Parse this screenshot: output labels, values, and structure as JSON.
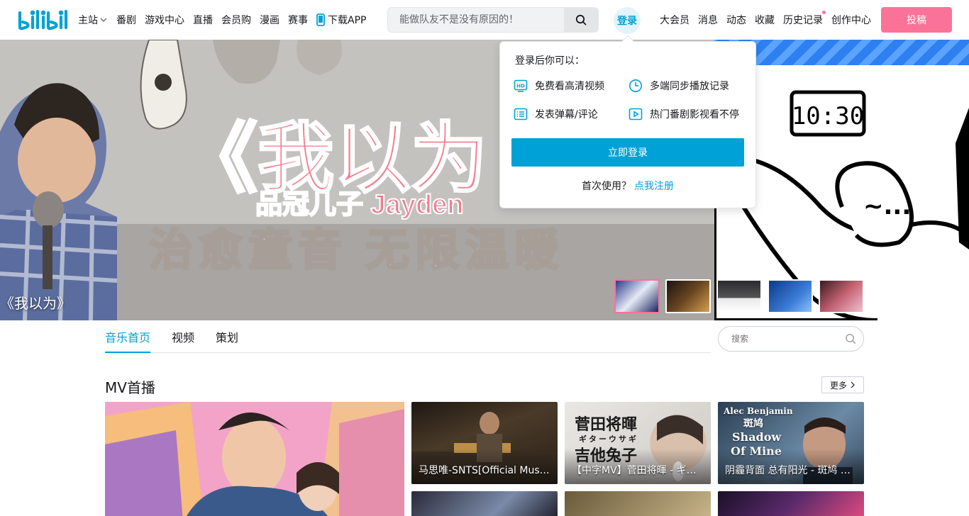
{
  "header": {
    "nav_left": [
      {
        "label": "主站",
        "has_dropdown": true
      },
      {
        "label": "番剧"
      },
      {
        "label": "游戏中心"
      },
      {
        "label": "直播"
      },
      {
        "label": "会员购"
      },
      {
        "label": "漫画"
      },
      {
        "label": "赛事"
      },
      {
        "label": "下载APP",
        "icon": "phone-icon"
      }
    ],
    "search_placeholder": "能做队友不是没有原因的！",
    "login_label": "登录",
    "nav_right": [
      "大会员",
      "消息",
      "动态",
      "收藏",
      "历史记录",
      "创作中心"
    ],
    "upload_label": "投稿"
  },
  "login_popover": {
    "title": "登录后你可以：",
    "features": [
      "免费看高清视频",
      "多端同步播放记录",
      "发表弹幕/评论",
      "热门番剧影视看不停"
    ],
    "login_button": "立即登录",
    "register_prompt": "首次使用？",
    "register_link": "点我注册"
  },
  "banner": {
    "title": "《我以为》",
    "artwork_text": [
      "《我以为",
      "品冠儿子 Jayden",
      "治愈童音 无限温暖"
    ],
    "side_clock": "10:30",
    "side_bubble": "~..."
  },
  "subnav": {
    "tabs": [
      "音乐首页",
      "视频",
      "策划"
    ],
    "search_placeholder": "搜索"
  },
  "mv_section": {
    "title": "MV首播",
    "more_label": "更多",
    "cards": [
      {
        "caption": "马思唯-SNTS[Official Music Video]"
      },
      {
        "caption": "【中字MV】菅田将暉 - ギターウサギ",
        "overlay": [
          "菅田将暉",
          "ギターウサギ",
          "吉他兔子"
        ]
      },
      {
        "caption": "阴霾背面 总有阳光 - 斑鸠 Alec Benjamin",
        "overlay": [
          "Alec Benjamin",
          "斑鸠",
          "Shadow",
          "Of Mine"
        ]
      }
    ]
  },
  "colors": {
    "brand_blue": "#00a1d6",
    "brand_pink": "#fb7299",
    "text": "#18191c"
  }
}
